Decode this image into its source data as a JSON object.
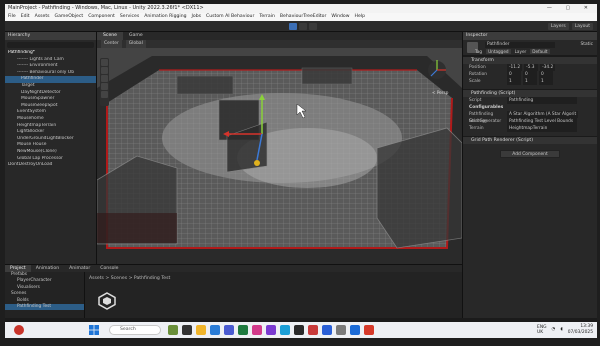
{
  "window": {
    "title": "MainProject - Pathfinding - Windows, Mac, Linux - Unity 2022.3.26f1* <DX11>"
  },
  "menu": [
    "File",
    "Edit",
    "Assets",
    "GameObject",
    "Component",
    "Services",
    "Animation Rigging",
    "Jobs",
    "Custom AI Behaviour",
    "Terrain",
    "BehaviourTreeEditor",
    "Window",
    "Help"
  ],
  "toolbar": {
    "layers_label": "Layers",
    "layout_label": "Layout"
  },
  "hierarchy": {
    "tab": "Hierarchy",
    "items": [
      "Pathfinding*",
      "------- Lights and Cam",
      "------- Environment",
      "------- Behavioural only Ob",
      "Pathfinder",
      "Target",
      "DayNightDetector",
      "MouseSpawner",
      "MouseSleepSpot",
      "EventSystem",
      "Mousehome",
      "HeightmapTerrain",
      "LightBlocker",
      "UnderGroundLightBlocker",
      "Mouse House",
      "NewMouse(Clone)",
      "Global Lap Processor",
      "DontDestroyOnLoad"
    ],
    "selected_index": 4
  },
  "scene": {
    "tabs": [
      "Scene",
      "Game"
    ],
    "tools": [
      "Center",
      "Global"
    ],
    "gizmo_label": "< Persp"
  },
  "inspector": {
    "tab": "Inspector",
    "object_name": "Pathfinder",
    "static_label": "Static",
    "tag_label": "Tag",
    "tag_value": "Untagged",
    "layer_label": "Layer",
    "layer_value": "Default",
    "transform": {
      "title": "Transform",
      "position": [
        "-11.2",
        "-5.3",
        "-34.2"
      ],
      "rotation": [
        "0",
        "0",
        "0"
      ],
      "scale": [
        "1",
        "1",
        "1"
      ]
    },
    "pathfinding": {
      "title": "Pathfinding (Script)",
      "script_label": "Script",
      "script_value": "Pathfinding",
      "configurables_label": "Configurables",
      "strategy_label": "Pathfinding Strategy",
      "strategy_value": "A Star Algorithm (A Star Algorit",
      "grid_label": "Grid Generator",
      "grid_value": "Pathfinding Test Level Bounds",
      "terrain_label": "Terrain",
      "terrain_value": "HeightmapTerrain"
    },
    "grid_renderer": {
      "title": "Grid Path Renderer (Script)"
    },
    "add_component": "Add Component"
  },
  "project": {
    "tabs": [
      "Project",
      "Animation",
      "Animator",
      "Console"
    ],
    "tree": [
      "Prefabs",
      "PlayerCharacter",
      "Visualisers",
      "Scenes",
      "Bolds",
      "Pathfinding Test"
    ],
    "breadcrumb": "Assets > Scenes > Pathfinding Test"
  },
  "taskbar": {
    "search_placeholder": "Search",
    "lang": "ENG",
    "region": "UK",
    "time": "13:39",
    "date": "07/03/2025"
  }
}
